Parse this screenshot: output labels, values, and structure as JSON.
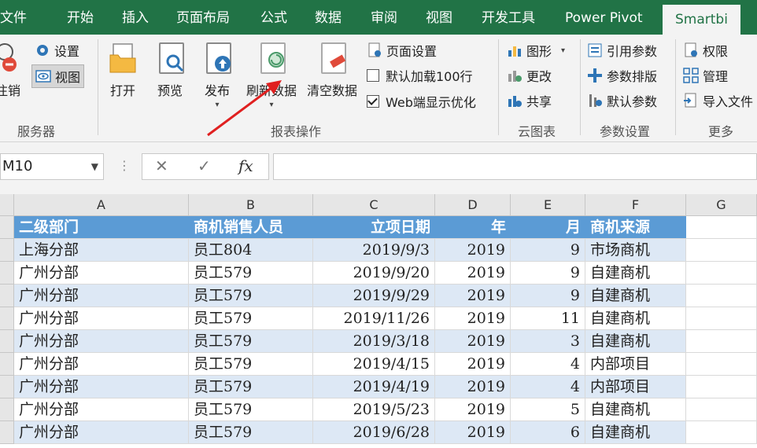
{
  "tabs": [
    "文件",
    "开始",
    "插入",
    "页面布局",
    "公式",
    "数据",
    "审阅",
    "视图",
    "开发工具",
    "Power Pivot",
    "Smartbi"
  ],
  "ribbon": {
    "server": {
      "login_label": "注销",
      "settings_label": "设置",
      "view_label": "视图",
      "group_label": "服务器"
    },
    "report": {
      "open": "打开",
      "preview": "预览",
      "publish": "发布",
      "refresh": "刷新数据",
      "clear": "清空数据",
      "page_setup": "页面设置",
      "default_load": "默认加载100行",
      "web_optimize": "Web端显示优化",
      "group_label": "报表操作"
    },
    "cloud": {
      "chart": "图形",
      "change": "更改",
      "share": "共享",
      "group_label": "云图表"
    },
    "params": {
      "cite": "引用参数",
      "arrange": "参数排版",
      "default": "默认参数",
      "group_label": "参数设置"
    },
    "more": {
      "perm": "权限",
      "manage": "管理",
      "import": "导入文件",
      "group_label": "更多"
    }
  },
  "formula_bar": {
    "name_box": "M10",
    "cancel": "✕",
    "enter": "✓",
    "fx": "fx"
  },
  "sheet": {
    "col_letters": [
      "A",
      "B",
      "C",
      "D",
      "E",
      "F",
      "G"
    ],
    "header": [
      "二级部门",
      "商机销售人员",
      "立项日期",
      "年",
      "月",
      "商机来源"
    ],
    "rows": [
      [
        "上海分部",
        "员工804",
        "2019/9/3",
        "2019",
        "9",
        "市场商机"
      ],
      [
        "广州分部",
        "员工579",
        "2019/9/20",
        "2019",
        "9",
        "自建商机"
      ],
      [
        "广州分部",
        "员工579",
        "2019/9/29",
        "2019",
        "9",
        "自建商机"
      ],
      [
        "广州分部",
        "员工579",
        "2019/11/26",
        "2019",
        "11",
        "自建商机"
      ],
      [
        "广州分部",
        "员工579",
        "2019/3/18",
        "2019",
        "3",
        "自建商机"
      ],
      [
        "广州分部",
        "员工579",
        "2019/4/15",
        "2019",
        "4",
        "内部项目"
      ],
      [
        "广州分部",
        "员工579",
        "2019/4/19",
        "2019",
        "4",
        "内部项目"
      ],
      [
        "广州分部",
        "员工579",
        "2019/5/23",
        "2019",
        "5",
        "自建商机"
      ],
      [
        "广州分部",
        "员工579",
        "2019/6/28",
        "2019",
        "6",
        "自建商机"
      ]
    ]
  },
  "colors": {
    "excel_green": "#217346",
    "header_blue": "#5b9bd5",
    "band_blue": "#dde8f5",
    "arrow_red": "#e02020"
  }
}
